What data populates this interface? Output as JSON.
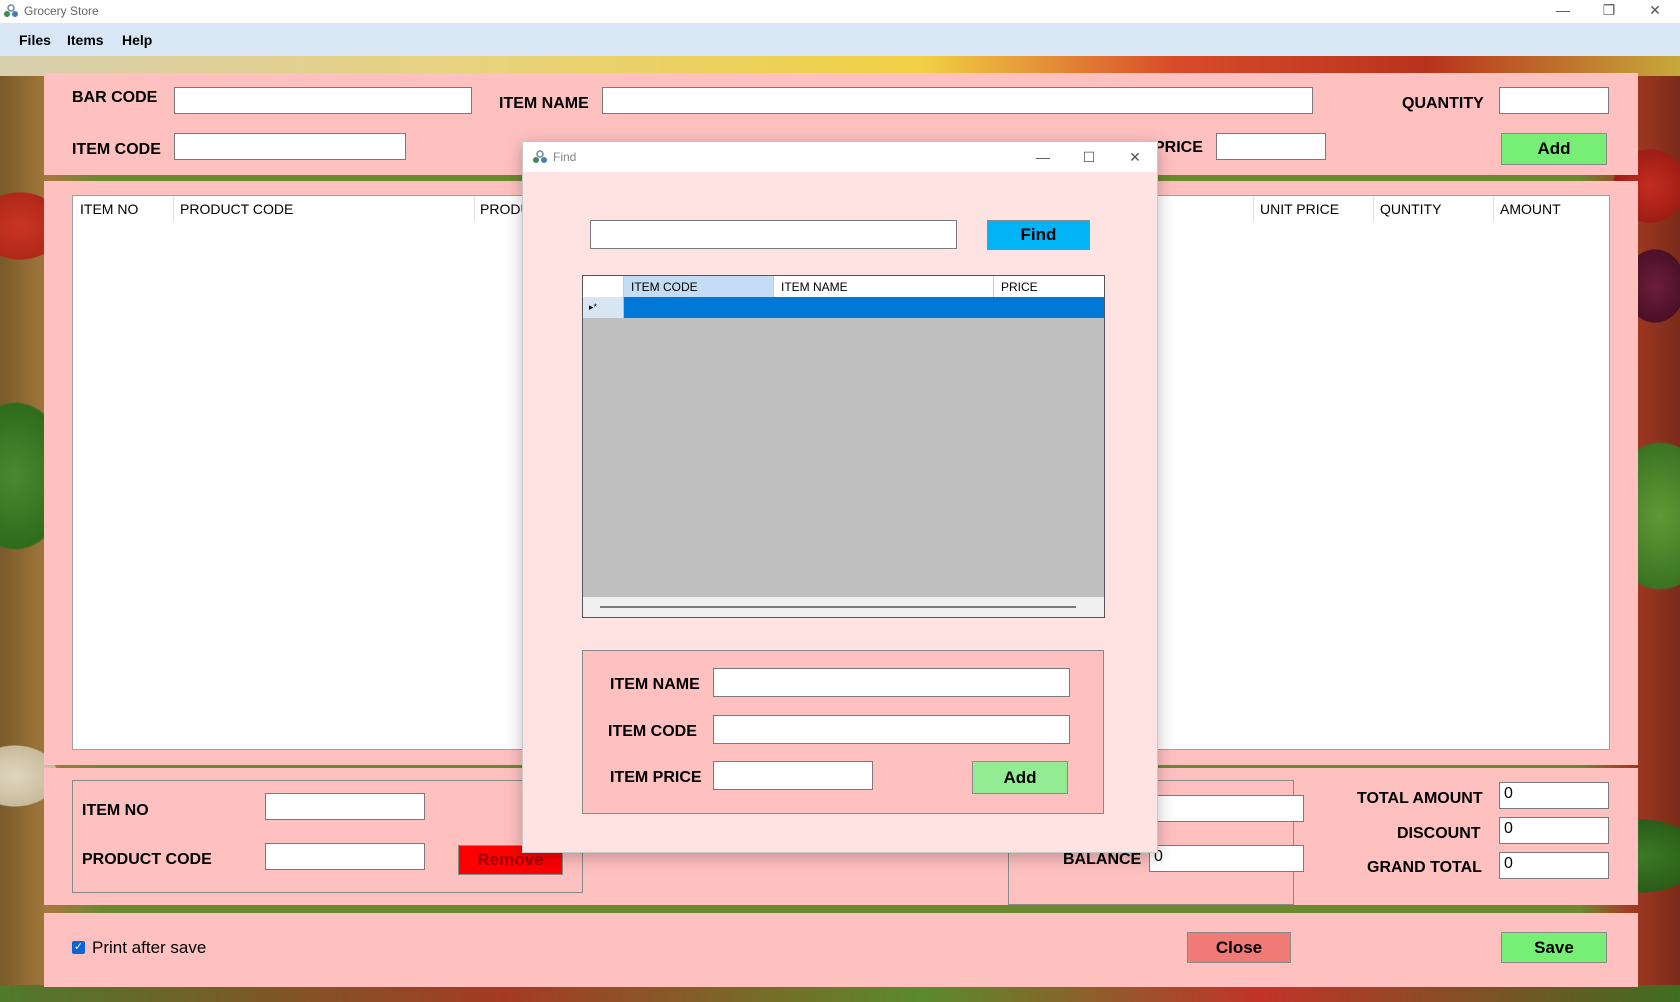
{
  "window": {
    "title": "Grocery Store"
  },
  "menu": {
    "files": "Files",
    "items": "Items",
    "help": "Help"
  },
  "entry": {
    "bar_code_label": "BAR CODE",
    "item_name_label": "ITEM NAME",
    "quantity_label": "QUANTITY",
    "item_code_label": "ITEM CODE",
    "price_label": "PRICE",
    "add_label": "Add"
  },
  "list": {
    "columns": [
      "ITEM NO",
      "PRODUCT CODE",
      "PRODU",
      "UNIT PRICE",
      "QUNTITY",
      "AMOUNT"
    ]
  },
  "remove_panel": {
    "item_no_label": "ITEM NO",
    "product_code_label": "PRODUCT CODE",
    "remove_label": "Remove"
  },
  "payment": {
    "balance_label": "BALANCE",
    "balance_value": "0"
  },
  "totals": {
    "total_amount_label": "TOTAL AMOUNT",
    "total_amount_value": "0",
    "discount_label": "DISCOUNT",
    "discount_value": "0",
    "grand_total_label": "GRAND TOTAL",
    "grand_total_value": "0"
  },
  "footer": {
    "print_after_save_label": "Print after save",
    "print_after_save_checked": true,
    "close_label": "Close",
    "save_label": "Save"
  },
  "find_dialog": {
    "title": "Find",
    "find_label": "Find",
    "search_value": "",
    "grid_columns": [
      "ITEM CODE",
      "ITEM NAME",
      "PRICE"
    ],
    "new_row_marker": "▸*",
    "item_name_label": "ITEM NAME",
    "item_code_label": "ITEM CODE",
    "item_price_label": "ITEM PRICE",
    "add_label": "Add"
  },
  "colors": {
    "panel": "#ffc0c0",
    "dialog": "#ffe3e3",
    "add_green": "#77ef77",
    "remove_red": "#ff0000",
    "close_salmon": "#f07a76",
    "find_blue": "#00b4f5",
    "selection_blue": "#0078d7"
  },
  "icons": [
    "app-icon",
    "minimize-icon",
    "maximize-icon",
    "close-icon",
    "checkbox-checked-icon"
  ]
}
